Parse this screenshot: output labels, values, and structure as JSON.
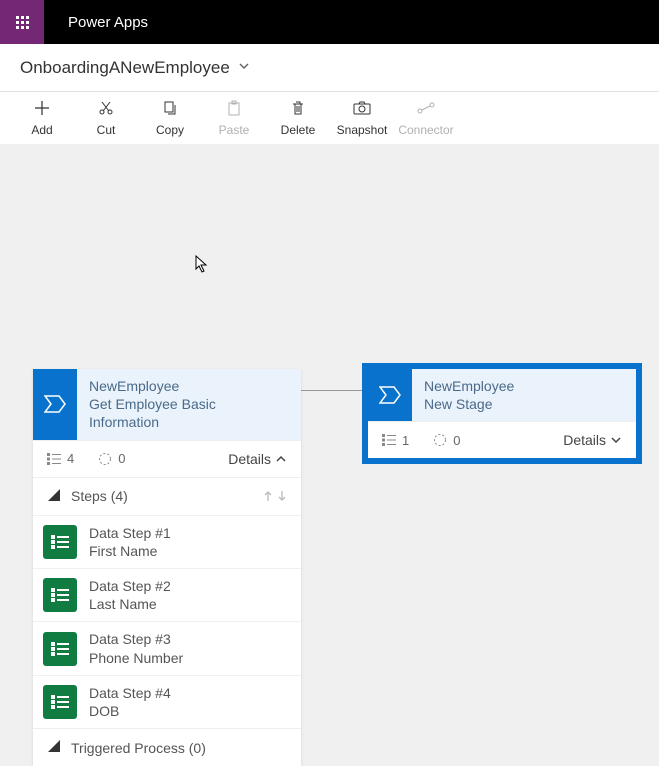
{
  "header": {
    "app_title": "Power Apps",
    "flow_name": "OnboardingANewEmployee"
  },
  "toolbar": {
    "add": "Add",
    "cut": "Cut",
    "copy": "Copy",
    "paste": "Paste",
    "delete": "Delete",
    "snapshot": "Snapshot",
    "connector": "Connector"
  },
  "stageA": {
    "entity": "NewEmployee",
    "title": "Get Employee Basic Information",
    "steps_count": "4",
    "branch_count": "0",
    "details_label": "Details",
    "steps_header": "Steps (4)",
    "triggered_header": "Triggered Process (0)",
    "steps": [
      {
        "name": "Data Step #1",
        "field": "First Name"
      },
      {
        "name": "Data Step #2",
        "field": "Last Name"
      },
      {
        "name": "Data Step #3",
        "field": "Phone Number"
      },
      {
        "name": "Data Step #4",
        "field": "DOB"
      }
    ]
  },
  "stageB": {
    "entity": "NewEmployee",
    "title": "New Stage",
    "steps_count": "1",
    "branch_count": "0",
    "details_label": "Details"
  }
}
